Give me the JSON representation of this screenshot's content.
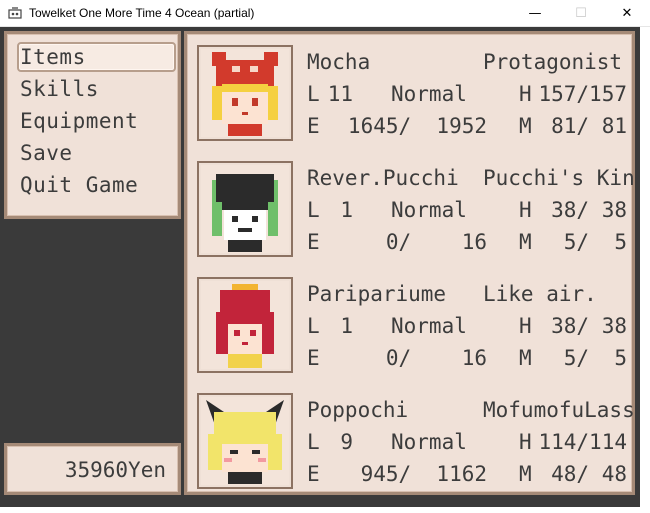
{
  "window": {
    "title": "Towelket One More Time 4 Ocean (partial)",
    "minimize": "—",
    "maximize": "☐",
    "close": "✕"
  },
  "menu": {
    "items": [
      {
        "label": "Items",
        "selected": true
      },
      {
        "label": "Skills",
        "selected": false
      },
      {
        "label": "Equipment",
        "selected": false
      },
      {
        "label": "Save",
        "selected": false
      },
      {
        "label": "Quit Game",
        "selected": false
      }
    ]
  },
  "gold": "35960Yen",
  "party": [
    {
      "name": "Mocha",
      "title": "Protagonist",
      "level_label": "L",
      "level": "11",
      "state": "Normal",
      "hp_label": "H",
      "hp": "157/157",
      "exp_label": "E",
      "exp": "1645/  1952",
      "mp_label": "M",
      "mp": "81/ 81",
      "hair": "#f5d040",
      "hat": "#d23a2c"
    },
    {
      "name": "Rever.Pucchi",
      "title": "Pucchi's Kin",
      "level_label": "L",
      "level": "1",
      "state": "Normal",
      "hp_label": "H",
      "hp": "38/ 38",
      "exp_label": "E",
      "exp": "0/    16",
      "mp_label": "M",
      "mp": "5/  5",
      "hair": "#2b2b2b",
      "hat": "#6fbf6a"
    },
    {
      "name": "Paripariume",
      "title": "Like air.",
      "level_label": "L",
      "level": "1",
      "state": "Normal",
      "hp_label": "H",
      "hp": "38/ 38",
      "exp_label": "E",
      "exp": "0/    16",
      "mp_label": "M",
      "mp": "5/  5",
      "hair": "#c2243a",
      "hat": "#f2b431"
    },
    {
      "name": "Poppochi",
      "title": "MofumofuLass",
      "level_label": "L",
      "level": "9",
      "state": "Normal",
      "hp_label": "H",
      "hp": "114/114",
      "exp_label": "E",
      "exp": "945/  1162",
      "mp_label": "M",
      "mp": "48/ 48",
      "hair": "#f2e46a",
      "hat": "#2b2b2b"
    }
  ]
}
